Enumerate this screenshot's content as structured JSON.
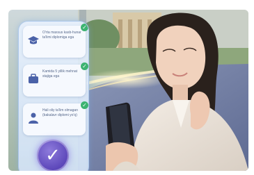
{
  "cards": [
    {
      "label": "O'rta maxsus kasb-hunar ta'limi diplomiga ega",
      "icon": "graduation-cap-icon"
    },
    {
      "label": "Kamida 5 yillik mehnat stajiga ega",
      "icon": "briefcase-icon"
    },
    {
      "label": "Hali oliy ta'lim olmagan (bakalavr diplomi yo'q)",
      "icon": "person-icon"
    }
  ],
  "check_glyph": "✓",
  "colors": {
    "accent_purple": "#5a45b8",
    "check_green": "#3cb371",
    "panel_blue": "#dce8f8"
  }
}
